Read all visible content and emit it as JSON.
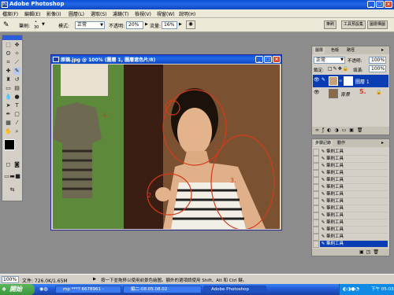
{
  "app": {
    "title": "Adobe Photoshop"
  },
  "menu": [
    "檔案(F)",
    "編輯(E)",
    "影像(I)",
    "圖層(L)",
    "選取(S)",
    "濾鏡(T)",
    "檢視(V)",
    "視窗(W)",
    "說明(H)"
  ],
  "options": {
    "brush_label": "筆刷:",
    "brush_size": "30",
    "mode_label": "模式:",
    "mode_value": "正常",
    "opacity_label": "不透明:",
    "opacity_value": "20%",
    "flow_label": "流量:",
    "flow_value": "16%",
    "tabs": [
      "筆刷",
      "工具預設集",
      "圖層構圖"
    ]
  },
  "document": {
    "title": "原稿.jpg @ 100% (圖層 1, 圖層遮色片/8)",
    "annotations": [
      "1.",
      "2.",
      "3.",
      "4."
    ]
  },
  "layers_panel": {
    "tabs": [
      "圖層",
      "色版",
      "路徑"
    ],
    "blend_mode": "正常",
    "opacity_label": "不透明:",
    "opacity_value": "100%",
    "fill_label": "填滿:",
    "fill_value": "100%",
    "lock_label": "鎖定:",
    "layers": [
      {
        "name": "圖層 1",
        "badge": "5."
      },
      {
        "name": "背景"
      }
    ]
  },
  "history_panel": {
    "tabs": [
      "步驟記錄",
      "動作"
    ],
    "items": [
      "筆刷工具",
      "筆刷工具",
      "筆刷工具",
      "筆刷工具",
      "筆刷工具",
      "筆刷工具",
      "筆刷工具",
      "筆刷工具",
      "筆刷工具",
      "筆刷工具",
      "筆刷工具",
      "筆刷工具",
      "筆刷工具",
      "筆刷工具"
    ]
  },
  "status": {
    "zoom": "100%",
    "doc": "文件: 726.0K/1.65M",
    "hint": "按一下並拖移以使用前景色繪圖。額外的選項請使用 Shift、Alt 和 Ctrl 鍵。"
  },
  "taskbar": {
    "start": "開始",
    "tasks": [
      "mp ***? 6678961 -",
      "編二-08.05.08.02",
      "Adobe Photoshop"
    ],
    "clock": "下午 05:03"
  },
  "colors": {
    "accent": "#0a4fd6",
    "annotation": "#d23a1a",
    "badge": "#e8341c"
  }
}
